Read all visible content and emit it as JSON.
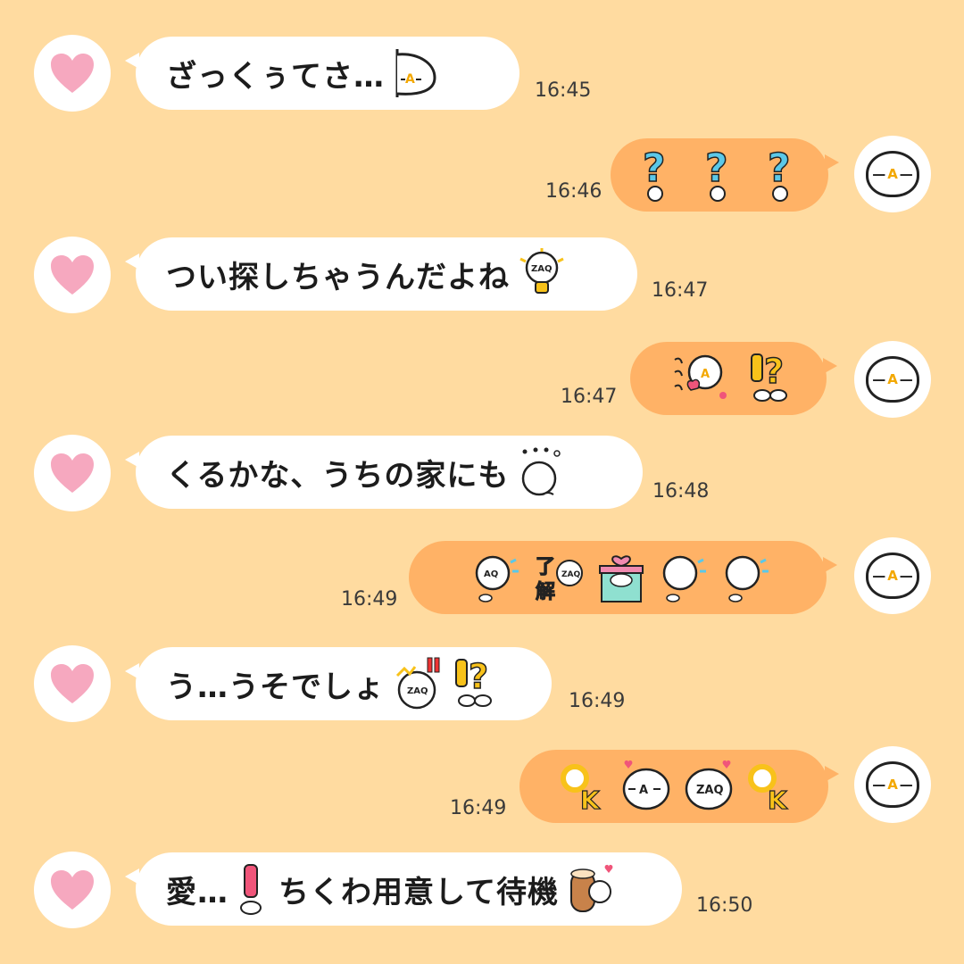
{
  "chat": {
    "messages": [
      {
        "side": "left",
        "text": "ざっくぅてさ…",
        "time": "16:45",
        "emojis": [
          "peek-face-emoji"
        ]
      },
      {
        "side": "right",
        "time": "16:46",
        "emojis": [
          "question-mark-emoji",
          "question-mark-emoji",
          "question-mark-emoji"
        ]
      },
      {
        "side": "left",
        "text": "つい探しちゃうんだよね",
        "time": "16:47",
        "emojis": [
          "idea-lightbulb-emoji"
        ]
      },
      {
        "side": "right",
        "time": "16:47",
        "emojis": [
          "kyun-heart-emoji",
          "exclamation-question-emoji"
        ]
      },
      {
        "side": "left",
        "text": "くるかな、うちの家にも",
        "time": "16:48",
        "emojis": [
          "thinking-dots-emoji"
        ]
      },
      {
        "side": "right",
        "time": "16:49",
        "emojis": [
          "running-emoji",
          "ryoukai-emoji",
          "gift-box-emoji",
          "running-emoji",
          "running-emoji"
        ]
      },
      {
        "side": "left",
        "text": "う…うそでしょ",
        "time": "16:49",
        "emojis": [
          "shocked-face-emoji",
          "exclamation-question-emoji"
        ]
      },
      {
        "side": "right",
        "time": "16:49",
        "emojis": [
          "ok-emoji",
          "kiss-face-emoji",
          "kiss-face-emoji",
          "ok-emoji"
        ]
      },
      {
        "side": "left",
        "text": "愛…",
        "text2": "ちくわ用意して待機",
        "time": "16:50",
        "emojis": [
          "exclamation-emoji",
          "chikuwa-emoji"
        ]
      }
    ]
  },
  "colors": {
    "background": "#ffdba0",
    "outgoing_bubble": "#ffb266",
    "incoming_bubble": "#ffffff",
    "heart": "#f6a8bf",
    "question": "#5bc8e8",
    "exclamation": "#f8c21a"
  }
}
